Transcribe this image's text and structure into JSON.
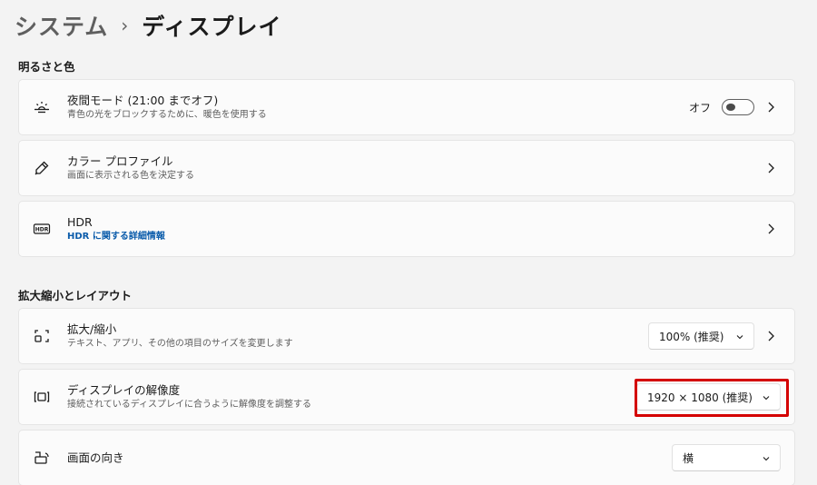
{
  "breadcrumb": {
    "parent": "システム",
    "separator": "›",
    "current": "ディスプレイ"
  },
  "sections": {
    "brightness_title": "明るさと色",
    "scale_title": "拡大縮小とレイアウト"
  },
  "night_light": {
    "title": "夜間モード (21:00 までオフ)",
    "subtitle": "青色の光をブロックするために、暖色を使用する",
    "toggle_label": "オフ",
    "toggle_state": "off",
    "icon": "brightness-icon"
  },
  "color_profile": {
    "title": "カラー プロファイル",
    "subtitle": "画面に表示される色を決定する",
    "icon": "pen-icon"
  },
  "hdr": {
    "title": "HDR",
    "subtitle": "HDR に関する詳細情報",
    "icon": "hdr-icon"
  },
  "scale": {
    "title": "拡大/縮小",
    "subtitle": "テキスト、アプリ、その他の項目のサイズを変更します",
    "value": "100% (推奨)",
    "icon": "scale-icon"
  },
  "resolution": {
    "title": "ディスプレイの解像度",
    "subtitle": "接続されているディスプレイに合うように解像度を調整する",
    "value": "1920 × 1080 (推奨)",
    "icon": "resolution-icon",
    "highlight_color": "#d40000"
  },
  "orientation": {
    "title": "画面の向き",
    "value": "横",
    "icon": "orientation-icon"
  },
  "colors": {
    "background": "#f3f3f3",
    "card": "#fbfbfb",
    "link": "#0b5cab",
    "highlight": "#d40000"
  }
}
